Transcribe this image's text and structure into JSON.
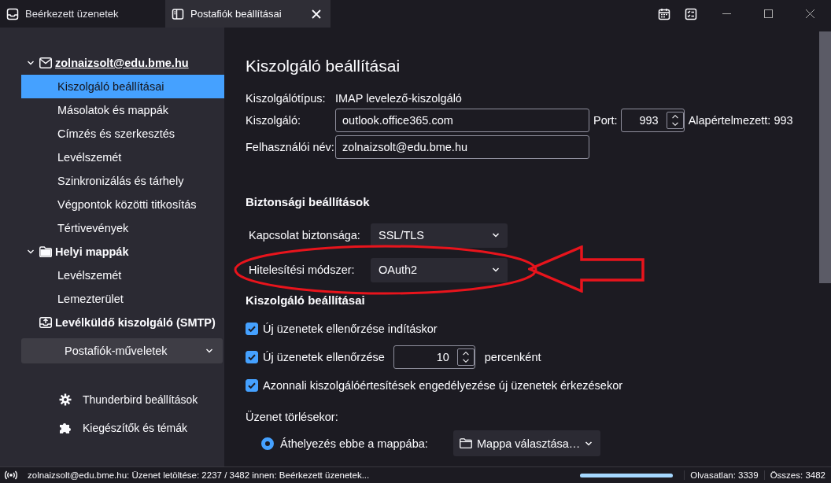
{
  "tabs": [
    {
      "label": "Beérkezett üzenetek",
      "kind": "inbox",
      "selected": false
    },
    {
      "label": "Postafiók beállításai",
      "kind": "settings",
      "selected": true
    }
  ],
  "sidebar": {
    "accounts": [
      {
        "label": "zolnaizsolt@edu.bme.hu",
        "kind": "mail",
        "expanded": true,
        "children": [
          {
            "label": "Kiszolgáló beállításai",
            "selected": true
          },
          {
            "label": "Másolatok és mappák",
            "selected": false
          },
          {
            "label": "Címzés és szerkesztés",
            "selected": false
          },
          {
            "label": "Levélszemét",
            "selected": false
          },
          {
            "label": "Szinkronizálás és tárhely",
            "selected": false
          },
          {
            "label": "Végpontok közötti titkosítás",
            "selected": false
          },
          {
            "label": "Tértivevények",
            "selected": false
          }
        ]
      },
      {
        "label": "Helyi mappák",
        "kind": "folder",
        "expanded": true,
        "children": [
          {
            "label": "Levélszemét",
            "selected": false
          },
          {
            "label": "Lemezterület",
            "selected": false
          }
        ]
      },
      {
        "label": "Levélküldő kiszolgáló (SMTP)",
        "kind": "smtp"
      }
    ],
    "actions_button": "Postafiók-műveletek",
    "links": [
      {
        "label": "Thunderbird beállítások",
        "kind": "gear"
      },
      {
        "label": "Kiegészítők és témák",
        "kind": "puzzle"
      }
    ]
  },
  "main": {
    "title": "Kiszolgáló beállításai",
    "server_type": {
      "label": "Kiszolgálótípus:",
      "value": "IMAP levelező-kiszolgáló"
    },
    "server": {
      "label": "Kiszolgáló:",
      "value": "outlook.office365.com"
    },
    "port": {
      "label": "Port:",
      "value": "993",
      "default": "Alapértelmezett: 993"
    },
    "username": {
      "label": "Felhasználói név:",
      "value": "zolnaizsolt@edu.bme.hu"
    },
    "security_heading": "Biztonsági beállítások",
    "connection_security": {
      "label": "Kapcsolat biztonsága:",
      "value": "SSL/TLS"
    },
    "auth_method": {
      "label": "Hitelesítési módszer:",
      "value": "OAuth2",
      "highlighted": true
    },
    "server_settings_heading": "Kiszolgáló beállításai",
    "checks": [
      {
        "kind": "plain",
        "label": "Új üzenetek ellenőrzése indításkor",
        "checked": true
      },
      {
        "kind": "interval",
        "label": "Új üzenetek ellenőrzése",
        "value": "10",
        "suffix": "percenként",
        "checked": true
      },
      {
        "kind": "plain",
        "label": "Azonnali kiszolgálóértesítések engedélyezése új üzenetek érkezésekor",
        "checked": true
      }
    ],
    "delete_label": "Üzenet törlésekor:",
    "delete_option": {
      "label": "Áthelyezés ebbe a mappába:",
      "selected": true,
      "folder": "Mappa választása…"
    }
  },
  "status_bar": {
    "text": "zolnaizsolt@edu.bme.hu: Üzenet letöltése: 2237 / 3482 innen: Beérkezett üzenetek...",
    "level": 1,
    "unread": "Olvasatlan: 3339",
    "total": "Összes: 3482"
  }
}
